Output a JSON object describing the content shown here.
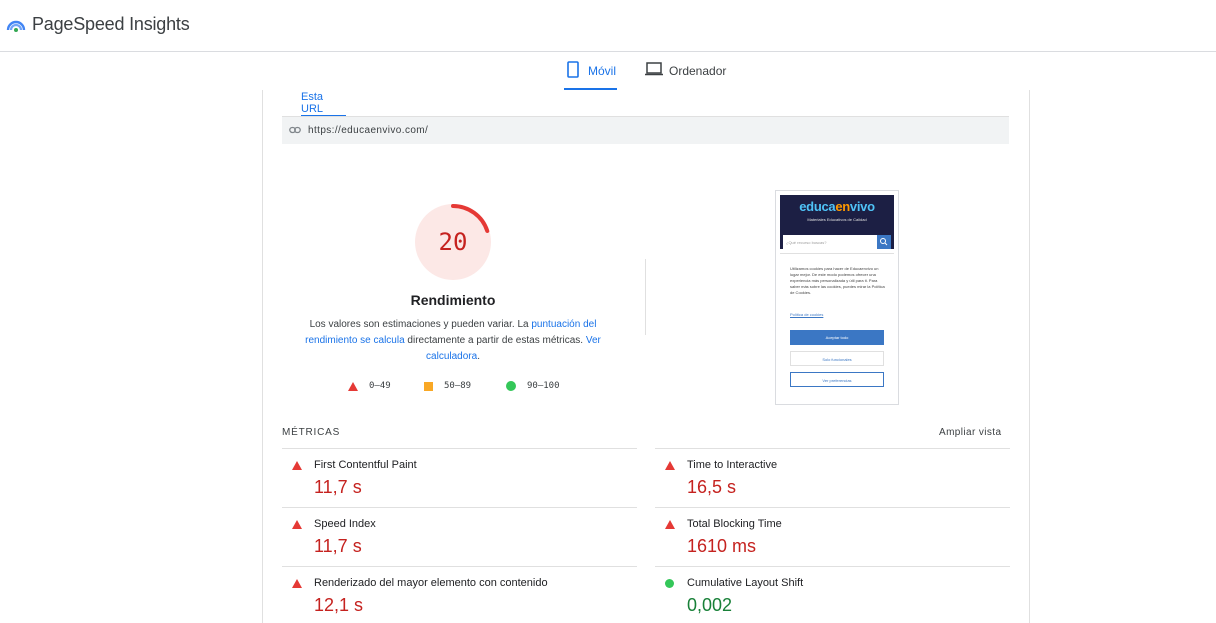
{
  "header": {
    "app_title": "PageSpeed Insights"
  },
  "device_tabs": [
    {
      "label": "Móvil",
      "icon": "phone-icon",
      "active": true
    },
    {
      "label": "Ordenador",
      "icon": "laptop-icon",
      "active": false
    }
  ],
  "url_section": {
    "tab_label": "Esta URL",
    "url": "https://educaenvivo.com/"
  },
  "performance": {
    "score": "20",
    "score_fraction": 0.2,
    "title": "Rendimiento",
    "desc_prefix": "Los valores son estimaciones y pueden variar. La ",
    "desc_link1": "puntuación del rendimiento se calcula",
    "desc_middle": " directamente a partir de estas métricas. ",
    "desc_link2": "Ver calculadora",
    "desc_suffix": "."
  },
  "legend": [
    {
      "range": "0–49",
      "shape": "triangle",
      "color": "#e53935"
    },
    {
      "range": "50–89",
      "shape": "square",
      "color": "#f9a825"
    },
    {
      "range": "90–100",
      "shape": "circle",
      "color": "#34c759"
    }
  ],
  "thumbnail": {
    "logo_part1": "educa",
    "logo_part2": "en",
    "logo_part3": "vivo",
    "tagline": "Materiales Educativos de Calidad",
    "search_placeholder": "¿Qué recurso buscas?",
    "cookie_text": "Utilizamos cookies para hacer de Educaenvivo un lugar mejor. De este modo podemos ofrecer una experiencia más personalizada y útil para ti. Para saber más sobre las cookies, puedes mirar la Política de Cookies.",
    "cookie_link": "Política de cookies",
    "accept_label": "Aceptar todo",
    "functional_label": "Solo funcionales",
    "prefs_label": "Ver preferencias"
  },
  "metrics": {
    "title": "MÉTRICAS",
    "expand_label": "Ampliar vista",
    "items": [
      {
        "label": "First Contentful Paint",
        "value": "11,7 s",
        "status": "bad"
      },
      {
        "label": "Time to Interactive",
        "value": "16,5 s",
        "status": "bad"
      },
      {
        "label": "Speed Index",
        "value": "11,7 s",
        "status": "bad"
      },
      {
        "label": "Total Blocking Time",
        "value": "1610 ms",
        "status": "bad"
      },
      {
        "label": "Renderizado del mayor elemento con contenido",
        "value": "12,1 s",
        "status": "bad"
      },
      {
        "label": "Cumulative Layout Shift",
        "value": "0,002",
        "status": "good"
      }
    ]
  },
  "colors": {
    "accent": "#1a73e8",
    "fail": "#c5221f",
    "pass": "#188038",
    "gauge_fail_bg": "#fce8e6",
    "gauge_fail_arc": "#e53935"
  }
}
